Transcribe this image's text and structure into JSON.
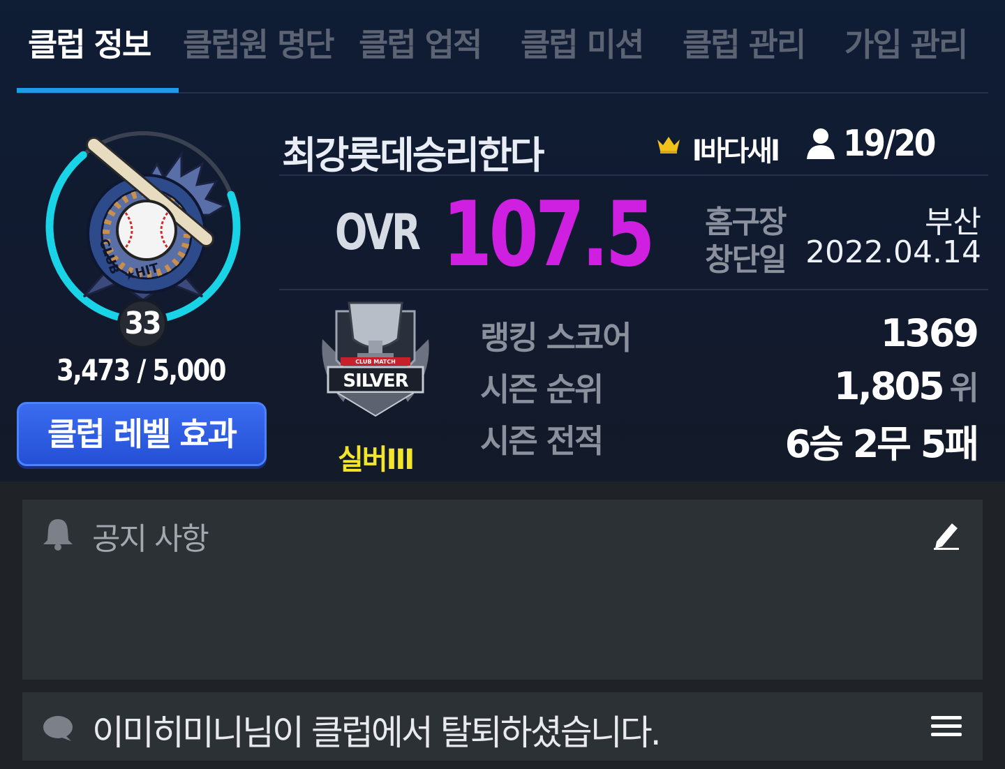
{
  "tabs": [
    {
      "label": "클럽 정보",
      "active": true
    },
    {
      "label": "클럽원 명단",
      "active": false
    },
    {
      "label": "클럽 업적",
      "active": false
    },
    {
      "label": "클럽 미션",
      "active": false
    },
    {
      "label": "클럽 관리",
      "active": false
    },
    {
      "label": "가입 관리",
      "active": false
    }
  ],
  "club": {
    "emblem_text": "CLUB★HIT",
    "level": "33",
    "exp": "3,473 / 5,000",
    "exp_fraction": 0.6946,
    "level_effect_button": "클럽 레벨 효과",
    "name": "최강롯데승리한다",
    "leader": "l바다새l",
    "members": "19/20",
    "ovr_label": "OVR",
    "ovr_value": "107.5",
    "home_label": "홈구장",
    "home_value": "부산",
    "founded_label": "창단일",
    "founded_value": "2022.04.14"
  },
  "tier": {
    "name": "실버III",
    "emblem_banner": "CLUB MATCH",
    "emblem_text": "SILVER"
  },
  "stats": {
    "ranking_score_label": "랭킹 스코어",
    "ranking_score_value": "1369",
    "season_rank_label": "시즌 순위",
    "season_rank_value": "1,805",
    "season_rank_unit": "위",
    "season_record_label": "시즌 전적",
    "season_record_value": "6승 2무 5패"
  },
  "notice": {
    "title": "공지 사항"
  },
  "news": {
    "text": "이미히미니님이 클럽에서 탈퇴하셨습니다."
  },
  "colors": {
    "accent": "#1e9be6",
    "ovr": "#cf1fe0",
    "tier": "#f2e52a",
    "ring": "#19d3e6"
  }
}
